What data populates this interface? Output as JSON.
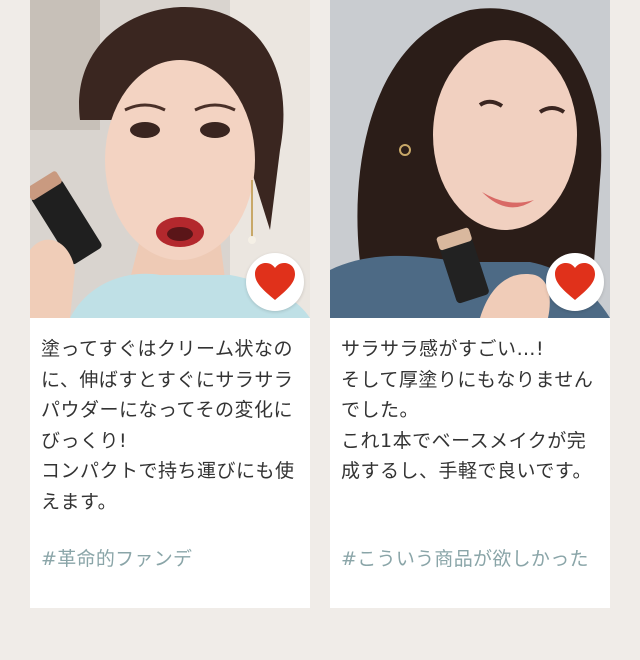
{
  "colors": {
    "background": "#f0ece8",
    "card": "#ffffff",
    "text": "#333333",
    "hashtag": "#8aa5a8",
    "heart": "#e0311b"
  },
  "reviews": [
    {
      "image_icon": "woman-holding-foundation-stick-photo",
      "like_icon": "heart-icon",
      "comment": "塗ってすぐはクリーム状なのに、伸ばすとすぐにサラサラパウダーになってその変化にびっくり!\nコンパクトで持ち運びにも使えます。",
      "hashtag": "#革命的ファンデ"
    },
    {
      "image_icon": "woman-smiling-with-foundation-stick-photo",
      "like_icon": "heart-icon",
      "comment": "サラサラ感がすごい…!\nそして厚塗りにもなりませんでした。\nこれ1本でベースメイクが完成するし、手軽で良いです。",
      "hashtag": "#こういう商品が欲しかった"
    }
  ]
}
